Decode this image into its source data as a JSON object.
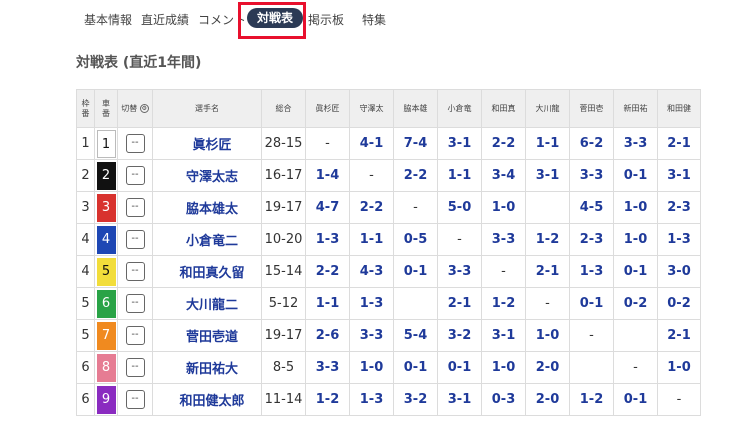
{
  "tabs": [
    "基本情報",
    "直近成績",
    "コメント",
    "対戦表",
    "掲示板",
    "特集"
  ],
  "section_title": "対戦表 (直近1年間)",
  "headers": {
    "waku": [
      "枠",
      "番"
    ],
    "car": [
      "車",
      "番"
    ],
    "switch": "切替",
    "name": "選手名",
    "total": "総合",
    "opponents": [
      "眞杉匠",
      "守澤太",
      "脇本雄",
      "小倉竜",
      "和田真",
      "大川龍",
      "菅田壱",
      "新田祐",
      "和田健"
    ]
  },
  "colors": {
    "tab_active_bg": "#2b3a55",
    "highlight": "#e8102d",
    "link": "#1f3a9a",
    "car_colors": [
      "#ffffff",
      "#111111",
      "#d8322e",
      "#1e47b4",
      "#f2dd3b",
      "#29a346",
      "#f08a1f",
      "#e67c93",
      "#8a2bc0"
    ]
  },
  "rows": [
    {
      "waku": "1",
      "car": "1",
      "switch": "--",
      "name": "眞杉匠",
      "total": "28-15",
      "vals": [
        "-",
        "4-1",
        "7-4",
        "3-1",
        "2-2",
        "1-1",
        "6-2",
        "3-3",
        "2-1"
      ]
    },
    {
      "waku": "2",
      "car": "2",
      "switch": "--",
      "name": "守澤太志",
      "total": "16-17",
      "vals": [
        "1-4",
        "-",
        "2-2",
        "1-1",
        "3-4",
        "3-1",
        "3-3",
        "0-1",
        "3-1"
      ]
    },
    {
      "waku": "3",
      "car": "3",
      "switch": "--",
      "name": "脇本雄太",
      "total": "19-17",
      "vals": [
        "4-7",
        "2-2",
        "-",
        "5-0",
        "1-0",
        "",
        "4-5",
        "1-0",
        "2-3"
      ]
    },
    {
      "waku": "4",
      "car": "4",
      "switch": "--",
      "name": "小倉竜二",
      "total": "10-20",
      "vals": [
        "1-3",
        "1-1",
        "0-5",
        "-",
        "3-3",
        "1-2",
        "2-3",
        "1-0",
        "1-3"
      ]
    },
    {
      "waku": "4",
      "car": "5",
      "switch": "--",
      "name": "和田真久留",
      "total": "15-14",
      "vals": [
        "2-2",
        "4-3",
        "0-1",
        "3-3",
        "-",
        "2-1",
        "1-3",
        "0-1",
        "3-0"
      ]
    },
    {
      "waku": "5",
      "car": "6",
      "switch": "--",
      "name": "大川龍二",
      "total": "5-12",
      "vals": [
        "1-1",
        "1-3",
        "",
        "2-1",
        "1-2",
        "-",
        "0-1",
        "0-2",
        "0-2"
      ]
    },
    {
      "waku": "5",
      "car": "7",
      "switch": "--",
      "name": "菅田壱道",
      "total": "19-17",
      "vals": [
        "2-6",
        "3-3",
        "5-4",
        "3-2",
        "3-1",
        "1-0",
        "-",
        "",
        "2-1"
      ]
    },
    {
      "waku": "6",
      "car": "8",
      "switch": "--",
      "name": "新田祐大",
      "total": "8-5",
      "vals": [
        "3-3",
        "1-0",
        "0-1",
        "0-1",
        "1-0",
        "2-0",
        "",
        "-",
        "1-0"
      ]
    },
    {
      "waku": "6",
      "car": "9",
      "switch": "--",
      "name": "和田健太郎",
      "total": "11-14",
      "vals": [
        "1-2",
        "1-3",
        "3-2",
        "3-1",
        "0-3",
        "2-0",
        "1-2",
        "0-1",
        "-"
      ]
    }
  ]
}
